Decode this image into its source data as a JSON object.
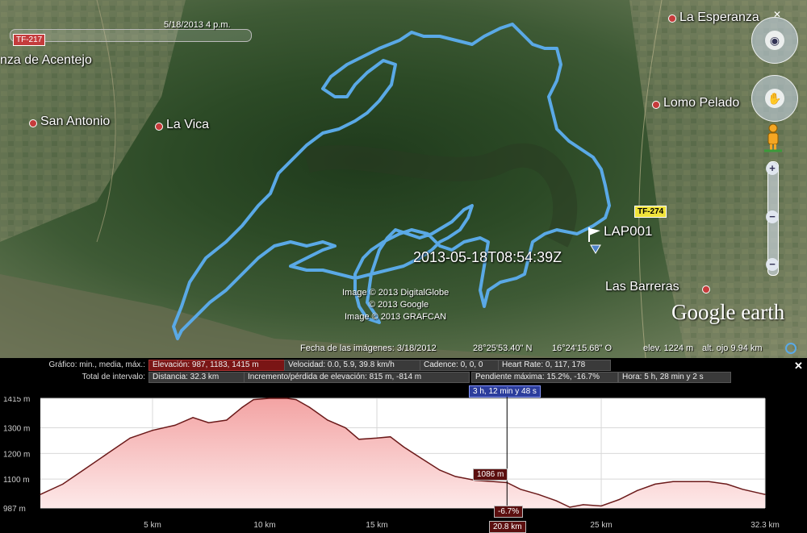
{
  "map": {
    "timeline_label": "5/18/2013   4 p.m.",
    "places": [
      {
        "name": "nza de Acentejo"
      },
      {
        "name": "San Antonio"
      },
      {
        "name": "La Vica"
      },
      {
        "name": "La Esperanza"
      },
      {
        "name": "Lomo Pelado"
      },
      {
        "name": "Las Barreras"
      }
    ],
    "roads": [
      {
        "label": "TF-217"
      },
      {
        "label": "TF-274"
      }
    ],
    "lap_label": "LAP001",
    "timestamp_label": "2013-05-18T08:54:39Z",
    "credits": [
      "Image © 2013 DigitalGlobe",
      "© 2013 Google",
      "Image © 2013 GRAFCAN"
    ],
    "logo": "Google earth",
    "status": {
      "imagery_date": "Fecha de las imágenes: 3/18/2012",
      "lat": "28°25'53.40\" N",
      "lon": "16°24'15.68\" O",
      "elev": "elev.  1224 m",
      "eye_alt": "alt. ojo   9.94 km"
    },
    "colors": {
      "track": "#5aa9e6"
    }
  },
  "panel": {
    "row1_label": "Gráfico: min., media, máx.:",
    "row2_label": "Total de intervalo:",
    "row1_cells": [
      {
        "text": "Elevación: 987, 1183, 1415 m",
        "highlight": true
      },
      {
        "text": "Velocidad: 0.0, 5.9, 39.8 km/h",
        "highlight": false
      },
      {
        "text": "Cadence: 0, 0, 0",
        "highlight": false
      },
      {
        "text": "Heart Rate: 0, 117, 178",
        "highlight": false
      }
    ],
    "row2_cells": [
      {
        "text": "Distancia: 32.3 km"
      },
      {
        "text": "Incremento/pérdida de elevación: 815 m, -814 m"
      },
      {
        "text": "Pendiente máxima: 15.2%, -16.7%"
      },
      {
        "text": "Hora: 5 h, 28 min y 2 s"
      }
    ],
    "cursor_time": "3 h, 12 min y 48 s",
    "cursor_elev": "1086 m",
    "cursor_slope": "-6.7%",
    "cursor_dist": "20.8 km",
    "close": "✕"
  },
  "chart_data": {
    "type": "area",
    "xlabel": "",
    "ylabel": "",
    "xlim": [
      0,
      32.3
    ],
    "ylim": [
      987,
      1415
    ],
    "y_ticks": [
      {
        "v": 1415,
        "label": "1415 m"
      },
      {
        "v": 1300,
        "label": "1300 m"
      },
      {
        "v": 1200,
        "label": "1200 m"
      },
      {
        "v": 1100,
        "label": "1100 m"
      },
      {
        "v": 987,
        "label": "987 m"
      }
    ],
    "x_ticks": [
      {
        "v": 5,
        "label": "5 km"
      },
      {
        "v": 10,
        "label": "10 km"
      },
      {
        "v": 15,
        "label": "15 km"
      },
      {
        "v": 25,
        "label": "25 km"
      },
      {
        "v": 32.3,
        "label": "32.3 km"
      }
    ],
    "cursor_x": 20.8,
    "x": [
      0,
      1,
      2,
      3,
      4,
      5,
      6,
      6.8,
      7.5,
      8.3,
      9,
      9.5,
      10.2,
      11,
      11.4,
      12,
      12.8,
      13.6,
      14.2,
      15,
      15.6,
      16.2,
      17,
      17.8,
      18.5,
      19.4,
      20.2,
      20.8,
      21.4,
      22.2,
      23,
      23.6,
      24.2,
      25,
      25.8,
      26.6,
      27.4,
      28.2,
      29,
      29.8,
      30.6,
      31.3,
      32.3
    ],
    "y": [
      1040,
      1080,
      1140,
      1200,
      1260,
      1290,
      1310,
      1340,
      1320,
      1330,
      1380,
      1410,
      1415,
      1415,
      1410,
      1380,
      1330,
      1300,
      1255,
      1260,
      1265,
      1225,
      1180,
      1135,
      1110,
      1095,
      1090,
      1086,
      1060,
      1040,
      1015,
      990,
      1000,
      995,
      1020,
      1055,
      1080,
      1090,
      1090,
      1090,
      1080,
      1060,
      1040
    ]
  }
}
